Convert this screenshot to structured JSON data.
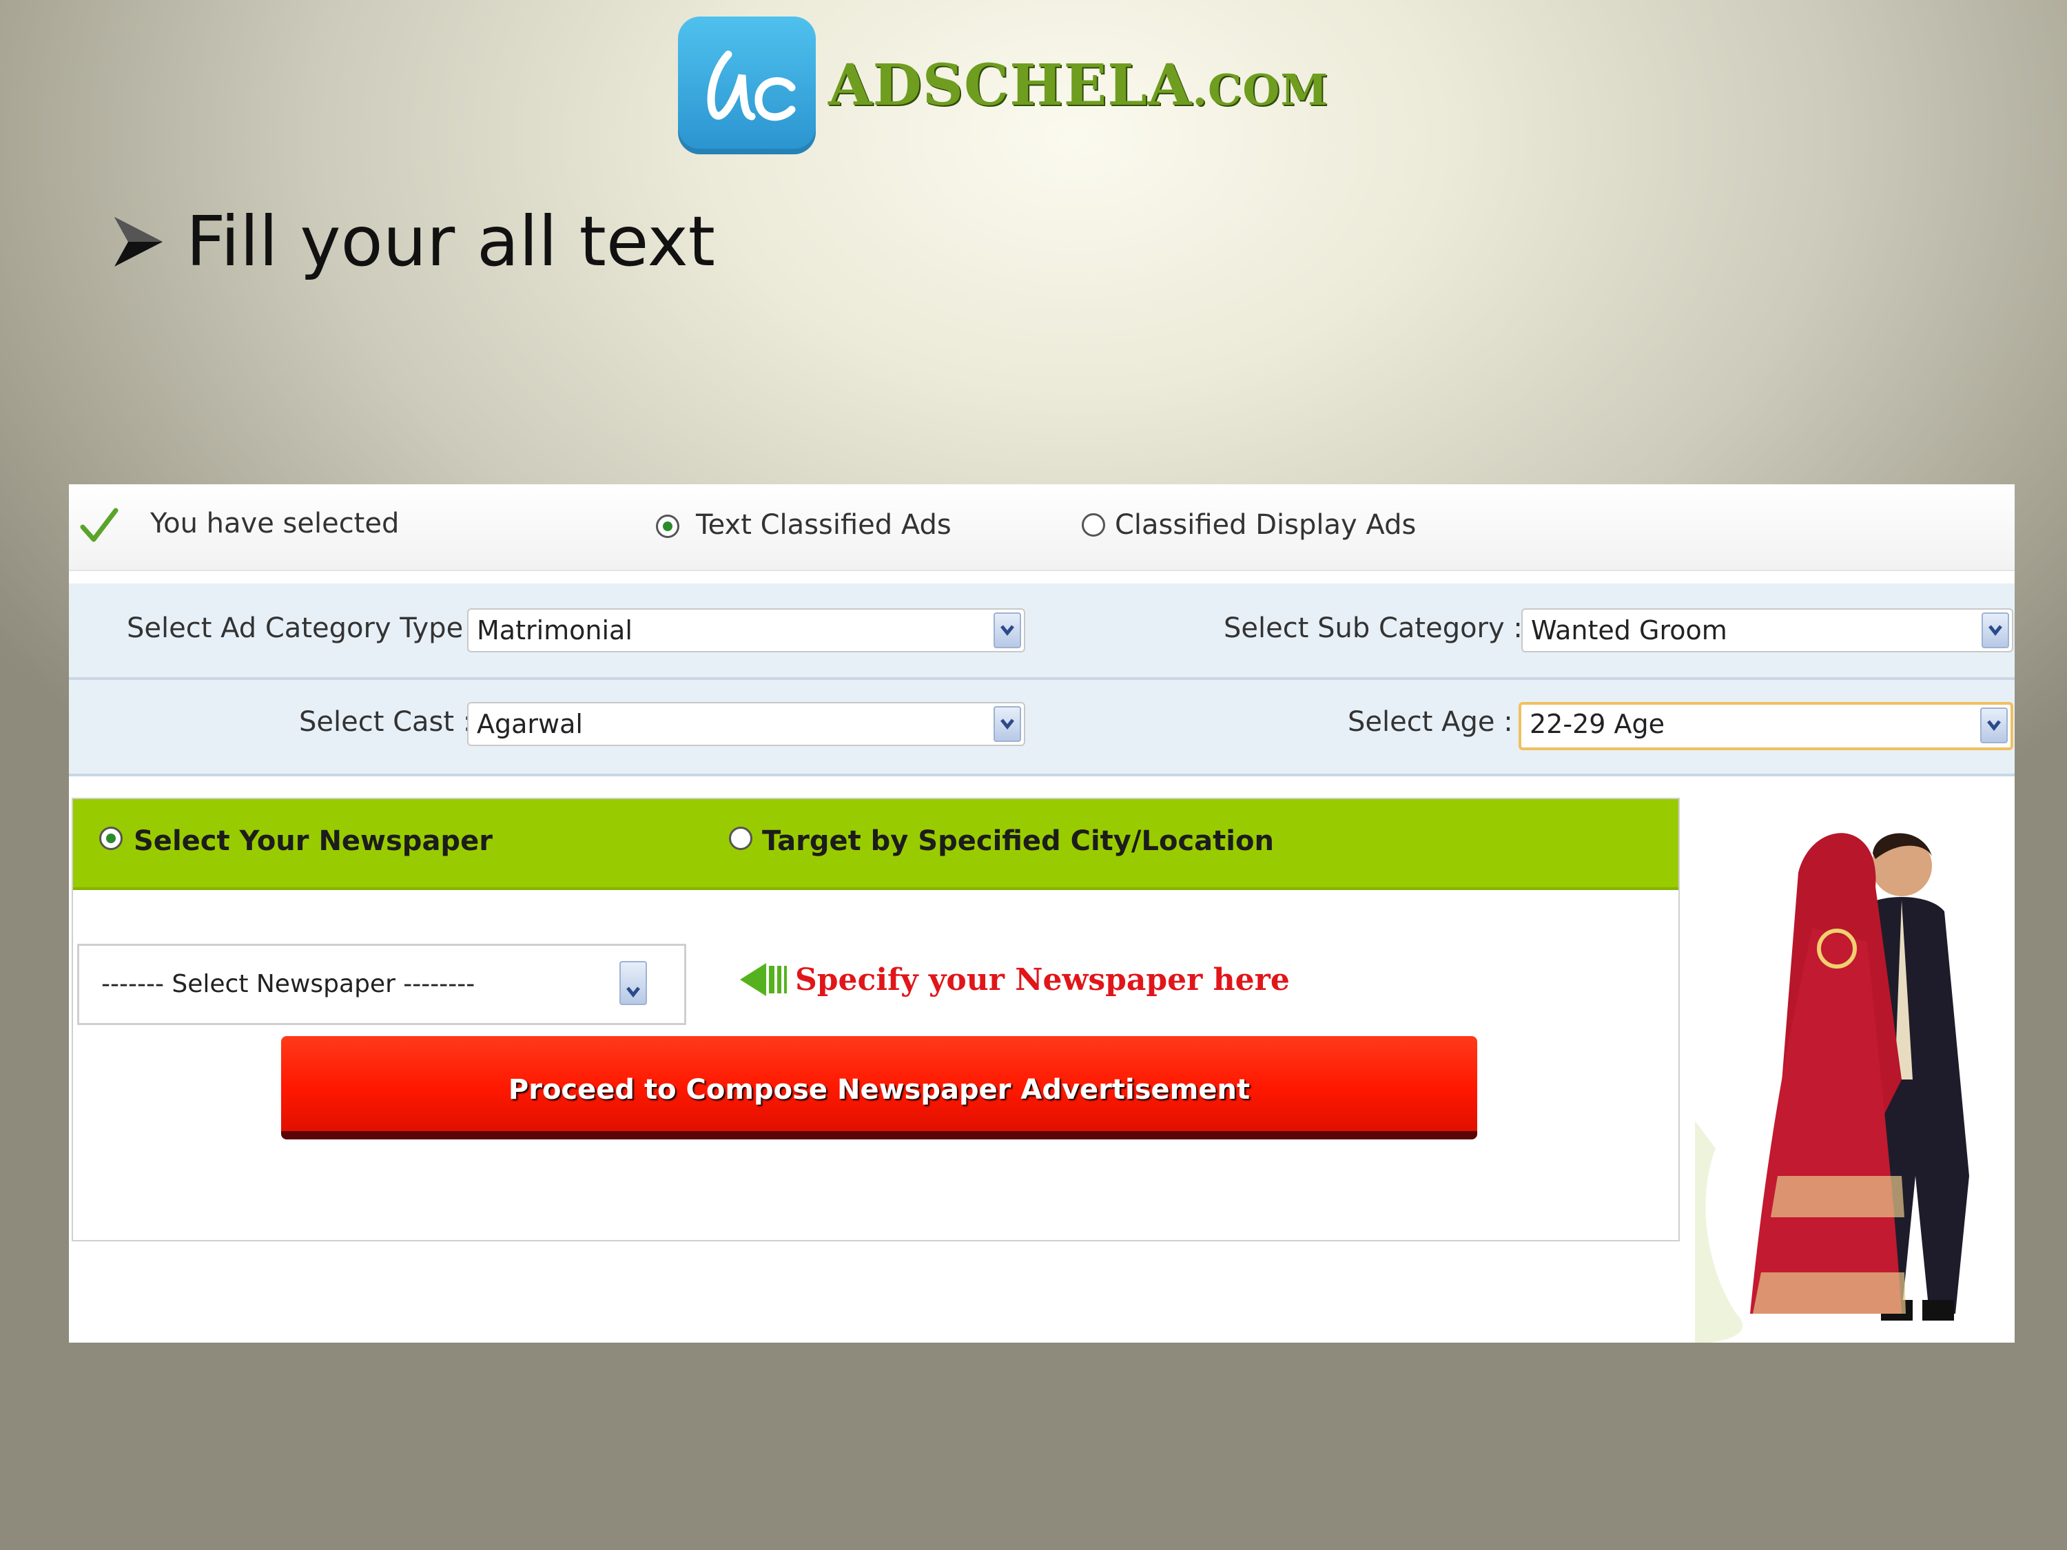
{
  "logo": {
    "text_main": "ADSCHELA",
    "text_domain": ".COM",
    "icon": "ac-logo-icon"
  },
  "heading": {
    "text": "Fill your all text",
    "icon": "arrow-bullet-icon"
  },
  "ad_type": {
    "label": "You have selected",
    "options": [
      {
        "label": "Text Classified Ads",
        "selected": true
      },
      {
        "label": "Classified Display Ads",
        "selected": false
      }
    ]
  },
  "form": {
    "category": {
      "label": "Select Ad Category Type :",
      "value": "Matrimonial"
    },
    "sub_category": {
      "label": "Select Sub Category :",
      "value": "Wanted Groom"
    },
    "cast": {
      "label": "Select Cast :",
      "value": "Agarwal"
    },
    "age": {
      "label": "Select Age :",
      "value": "22-29 Age"
    }
  },
  "targeting": {
    "options": [
      {
        "label": "Select Your Newspaper",
        "selected": true
      },
      {
        "label": "Target by Specified City/Location",
        "selected": false
      }
    ],
    "newspaper_select": {
      "value": "------- Select Newspaper --------"
    },
    "hint": "Specify your Newspaper here"
  },
  "proceed_button": {
    "label": "Proceed to Compose Newspaper Advertisement"
  },
  "colors": {
    "green_bar": "#99cc00",
    "proceed": "#ff1800",
    "hint": "#e0161a",
    "logo_green": "#6f9d1f"
  }
}
